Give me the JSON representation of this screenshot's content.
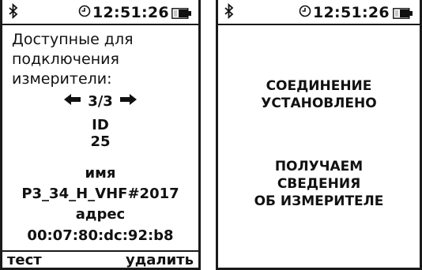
{
  "left_screen": {
    "status": {
      "time": "12:51:26",
      "bluetooth_icon": "bluetooth-icon",
      "clock_icon": "clock-icon",
      "battery_icon": "battery-icon"
    },
    "heading_lines": [
      "Доступные для",
      "подключения",
      "измерители:"
    ],
    "pager": {
      "text": "3/3",
      "prev_icon": "arrow-left-icon",
      "next_icon": "arrow-right-icon"
    },
    "id_label": "ID",
    "id_value": "25",
    "name_label": "имя",
    "name_value": "P3_34_H_VHF#2017",
    "address_label": "адрес",
    "address_value": "00:07:80:dc:92:b8",
    "softkeys": {
      "left": "тест",
      "right": "удалить"
    }
  },
  "right_screen": {
    "status": {
      "time": "12:51:26",
      "bluetooth_icon": "bluetooth-icon",
      "clock_icon": "clock-icon",
      "battery_icon": "battery-icon"
    },
    "message1": [
      "СОЕДИНЕНИЕ",
      "УСТАНОВЛЕНО"
    ],
    "message2": [
      "ПОЛУЧАЕМ",
      "СВЕДЕНИЯ",
      "ОБ ИЗМЕРИТЕЛЕ"
    ]
  }
}
